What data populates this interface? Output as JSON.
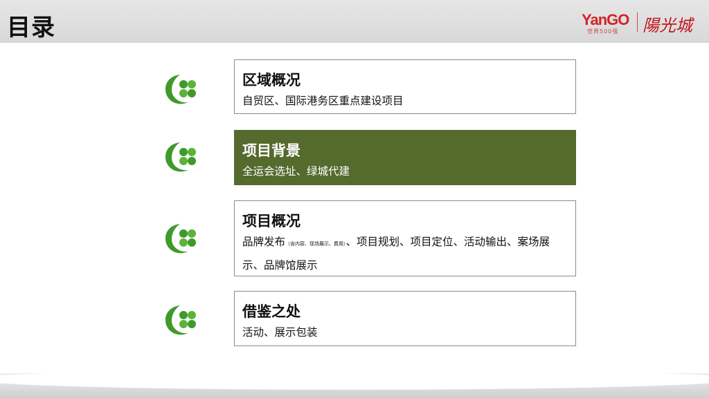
{
  "header": {
    "title": "目录",
    "logo": {
      "english": "YanGO",
      "tagline": "世界500强",
      "chinese": "陽光城"
    }
  },
  "sections": [
    {
      "title": "区域概况",
      "desc": "自贸区、国际港务区重点建设项目"
    },
    {
      "title": "项目背景",
      "desc": "全运会选址、绿城代建"
    },
    {
      "title": "项目概况",
      "desc_part1": "品牌发布",
      "desc_note": "（含内容、现场展示、费用）",
      "desc_part2": "、项目规划、项目定位、活动输出、案场展示、品牌馆展示"
    },
    {
      "title": "借鉴之处",
      "desc": "活动、展示包装"
    }
  ],
  "colors": {
    "accent": "#556a2d",
    "leaf_green": "#3f9a2a",
    "brand_red": "#d2232a"
  }
}
